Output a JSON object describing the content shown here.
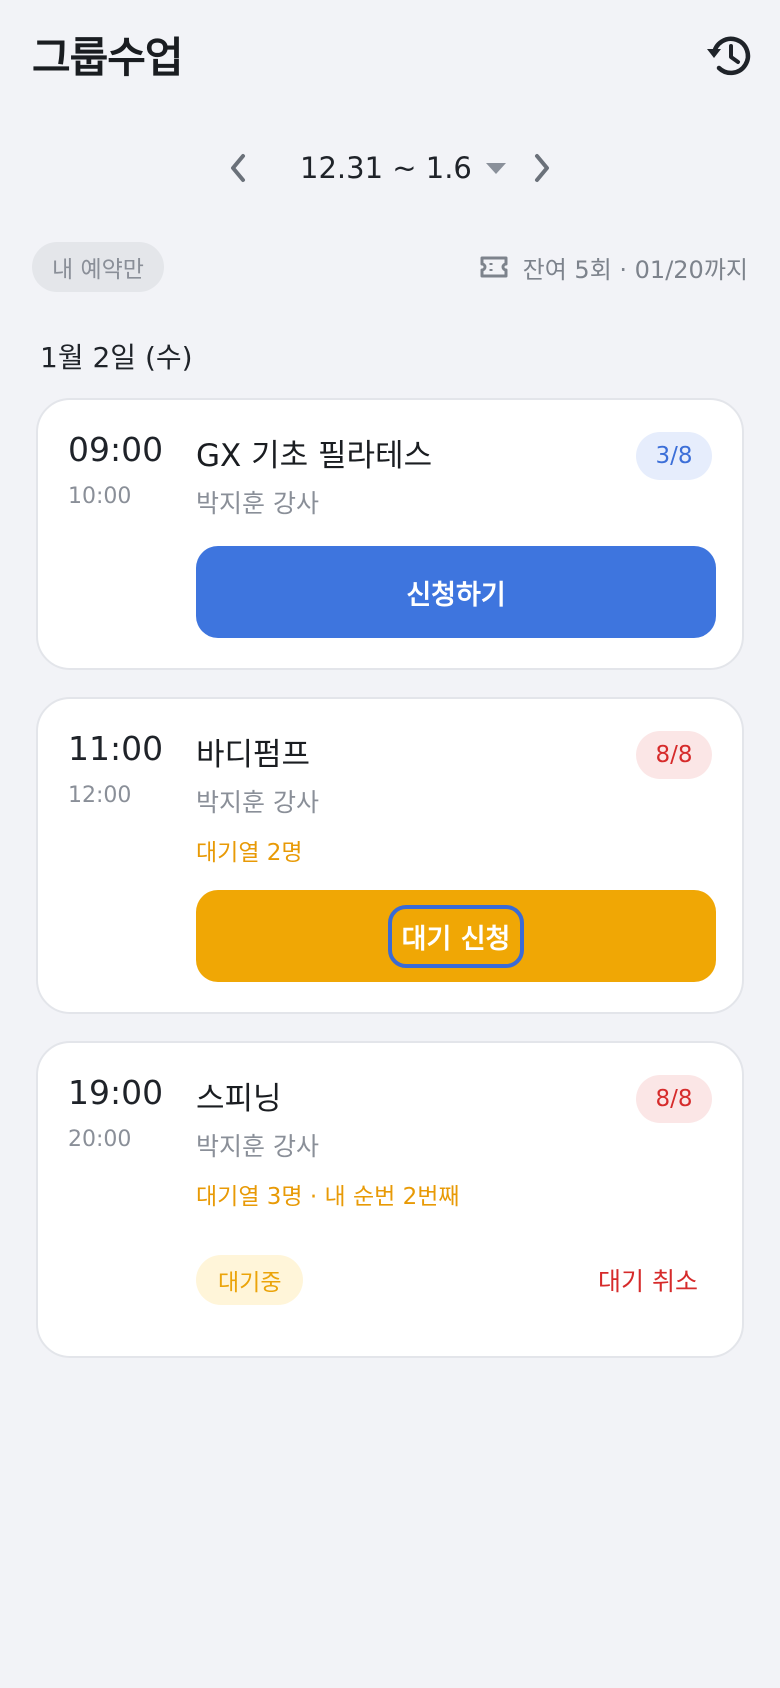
{
  "header": {
    "title": "그룹수업",
    "history_icon": "history-icon"
  },
  "week_nav": {
    "range": "12.31 ~ 1.6",
    "prev_icon": "chevron-left-icon",
    "next_icon": "chevron-right-icon",
    "dropdown_icon": "caret-down-icon"
  },
  "filter": {
    "my_reservations_label": "내 예약만"
  },
  "ticket": {
    "icon": "ticket-icon",
    "text": "잔여 5회 · 01/20까지"
  },
  "date_label": "1월 2일 (수)",
  "classes": [
    {
      "start": "09:00",
      "end": "10:00",
      "name": "GX 기초 필라테스",
      "teacher": "박지훈 강사",
      "capacity": "3/8",
      "action": "신청하기"
    },
    {
      "start": "11:00",
      "end": "12:00",
      "name": "바디펌프",
      "teacher": "박지훈 강사",
      "capacity": "8/8",
      "wait_info": "대기열 2명",
      "action": "대기 신청"
    },
    {
      "start": "19:00",
      "end": "20:00",
      "name": "스피닝",
      "teacher": "박지훈 강사",
      "capacity": "8/8",
      "wait_info": "대기열 3명 · 내 순번 2번째",
      "status": "대기중",
      "cancel": "대기 취소"
    }
  ],
  "colors": {
    "background": "#f2f3f7",
    "primary": "#3e75de",
    "waitlist": "#f0a705",
    "danger": "#d62b2b"
  }
}
